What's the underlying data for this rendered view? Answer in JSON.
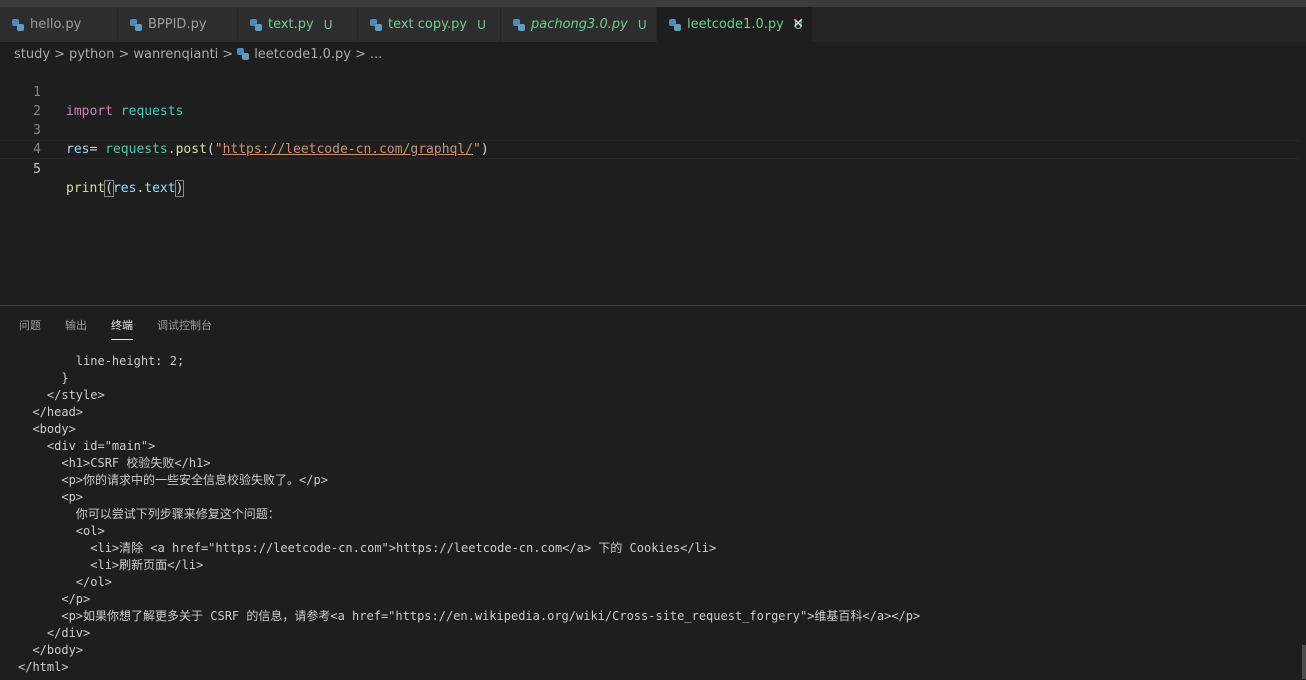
{
  "tabs": [
    {
      "label": "hello.py",
      "status": ""
    },
    {
      "label": "BPPID.py",
      "status": ""
    },
    {
      "label": "text.py",
      "status": "U"
    },
    {
      "label": "text copy.py",
      "status": "U"
    },
    {
      "label": "pachong3.0.py",
      "status": "U"
    },
    {
      "label": "leetcode1.0.py",
      "status": "U"
    }
  ],
  "breadcrumb": {
    "parts": [
      "study",
      "python",
      "wanrenqianti",
      "leetcode1.0.py",
      "..."
    ],
    "separator": ">"
  },
  "editor": {
    "line_numbers": [
      "1",
      "2",
      "3",
      "4",
      "5"
    ],
    "line1": {
      "kw": "import",
      "mod": "requests"
    },
    "line3": {
      "var": "res",
      "eq": "= ",
      "mod": "requests",
      "dot": ".",
      "fn": "post",
      "open": "(",
      "q1": "\"",
      "url": "https://leetcode-cn.com/graphql/",
      "q2": "\"",
      "close": ")"
    },
    "line5": {
      "fn": "print",
      "open": "(",
      "var": "res",
      "dot": ".",
      "attr": "text",
      "close": ")"
    }
  },
  "panel": {
    "tabs": [
      "问题",
      "输出",
      "终端",
      "调试控制台"
    ],
    "active_tab": "终端"
  },
  "terminal": {
    "lines": [
      "        line-height: 2;",
      "      }",
      "    </style>",
      "  </head>",
      "  <body>",
      "    <div id=\"main\">",
      "      <h1>CSRF 校验失败</h1>",
      "      <p>你的请求中的一些安全信息校验失败了。</p>",
      "      <p>",
      "        你可以尝试下列步骤来修复这个问题：",
      "        <ol>",
      "          <li>清除 <a href=\"https://leetcode-cn.com\">https://leetcode-cn.com</a> 下的 Cookies</li>",
      "          <li>刷新页面</li>",
      "        </ol>",
      "      </p>",
      "      <p>如果你想了解更多关于 CSRF 的信息，请参考<a href=\"https://en.wikipedia.org/wiki/Cross-site_request_forgery\">维基百科</a></p>",
      "    </div>",
      "  </body>",
      "</html>"
    ]
  },
  "colors": {
    "untracked": "#73c991",
    "keyword": "#c586c0",
    "module": "#4ec9b0",
    "string": "#ce9178"
  }
}
